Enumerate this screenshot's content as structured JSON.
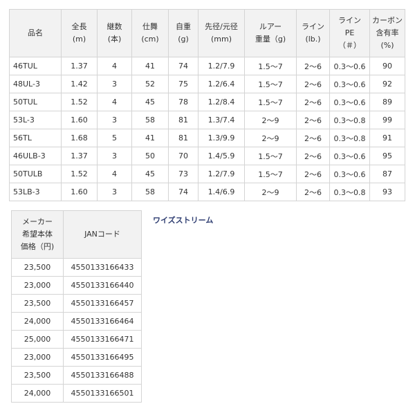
{
  "spec_table": {
    "headers": [
      [
        "品名"
      ],
      [
        "全長",
        "(m)"
      ],
      [
        "継数",
        "(本)"
      ],
      [
        "仕舞",
        "(cm)"
      ],
      [
        "自重",
        "(g)"
      ],
      [
        "先径/元径",
        "(mm)"
      ],
      [
        "ルアー",
        "重量（g)"
      ],
      [
        "ライン",
        "(lb.)"
      ],
      [
        "ライン",
        "PE",
        "（＃）"
      ],
      [
        "カーボン",
        "含有率",
        "(%)"
      ]
    ],
    "rows": [
      [
        "46TUL",
        "1.37",
        "4",
        "41",
        "74",
        "1.2/7.9",
        "1.5～7",
        "2～6",
        "0.3～0.6",
        "90"
      ],
      [
        "48UL-3",
        "1.42",
        "3",
        "52",
        "75",
        "1.2/6.4",
        "1.5～7",
        "2～6",
        "0.3～0.6",
        "92"
      ],
      [
        "50TUL",
        "1.52",
        "4",
        "45",
        "78",
        "1.2/8.4",
        "1.5～7",
        "2～6",
        "0.3～0.6",
        "89"
      ],
      [
        "53L-3",
        "1.60",
        "3",
        "58",
        "81",
        "1.3/7.4",
        "2～9",
        "2～6",
        "0.3～0.8",
        "99"
      ],
      [
        "56TL",
        "1.68",
        "5",
        "41",
        "81",
        "1.3/9.9",
        "2～9",
        "2～6",
        "0.3～0.8",
        "91"
      ],
      [
        "46ULB-3",
        "1.37",
        "3",
        "50",
        "70",
        "1.4/5.9",
        "1.5～7",
        "2～6",
        "0.3～0.6",
        "95"
      ],
      [
        "50TULB",
        "1.52",
        "4",
        "45",
        "73",
        "1.2/7.9",
        "1.5～7",
        "2～6",
        "0.3～0.6",
        "87"
      ],
      [
        "53LB-3",
        "1.60",
        "3",
        "58",
        "74",
        "1.4/6.9",
        "2～9",
        "2～6",
        "0.3～0.8",
        "93"
      ]
    ]
  },
  "price_table": {
    "headers": [
      [
        "メーカー",
        "希望本体",
        "価格（円)"
      ],
      [
        "JANコード"
      ]
    ],
    "rows": [
      [
        "23,500",
        "4550133166433"
      ],
      [
        "23,000",
        "4550133166440"
      ],
      [
        "23,500",
        "4550133166457"
      ],
      [
        "24,000",
        "4550133166464"
      ],
      [
        "25,000",
        "4550133166471"
      ],
      [
        "23,000",
        "4550133166495"
      ],
      [
        "23,500",
        "4550133166488"
      ],
      [
        "24,000",
        "4550133166501"
      ]
    ]
  },
  "series_link": "ワイズストリーム",
  "colors": {
    "header_bg": "#f2f2f2",
    "border": "#d4d4d4",
    "link": "#2e3d71",
    "text": "#333333"
  }
}
